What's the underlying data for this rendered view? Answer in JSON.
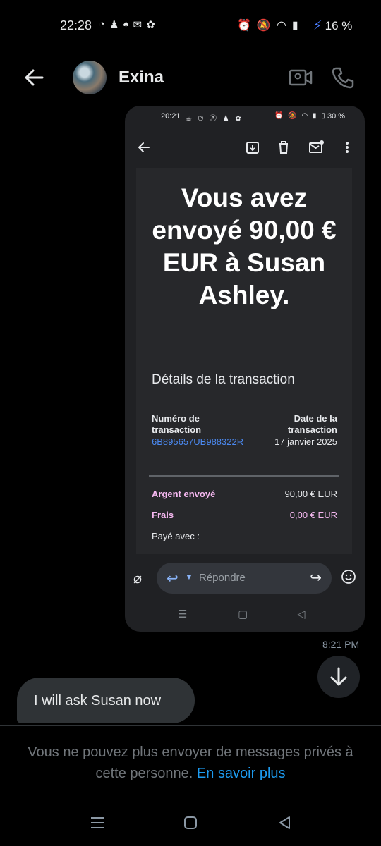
{
  "status_bar": {
    "time": "22:28",
    "battery": "16 %",
    "left_icons": [
      "whatsapp-icon",
      "notification-icon",
      "notification-icon",
      "mail-icon",
      "settings-icon"
    ],
    "right_icons": [
      "alarm-icon",
      "mute-icon",
      "wifi-icon",
      "signal-icon",
      "charging-icon"
    ]
  },
  "header": {
    "contact_name": "Exina"
  },
  "screenshot": {
    "status_time": "20:21",
    "status_battery": "30 %",
    "headline": "Vous avez envoyé 90,00 € EUR à Susan Ashley.",
    "details_title": "Détails de la transaction",
    "transaction_number_label": "Numéro de transaction",
    "transaction_number": "6B895657UB988322R",
    "date_label": "Date de la transaction",
    "date_value": "17 janvier 2025",
    "sent_label": "Argent envoyé",
    "sent_value": "90,00 € EUR",
    "fees_label": "Frais",
    "fees_value": "0,00 € EUR",
    "paid_with_label": "Payé avec :",
    "reply_placeholder": "Répondre",
    "colors": {
      "link": "#4b89f0",
      "label_pink": "#f5b8f0",
      "background": "#202124"
    }
  },
  "message_time": "8:21 PM",
  "incoming_message": "I will ask Susan now",
  "notice": {
    "text": "Vous ne pouvez plus envoyer de messages privés à cette personne.",
    "link": "En savoir plus"
  }
}
